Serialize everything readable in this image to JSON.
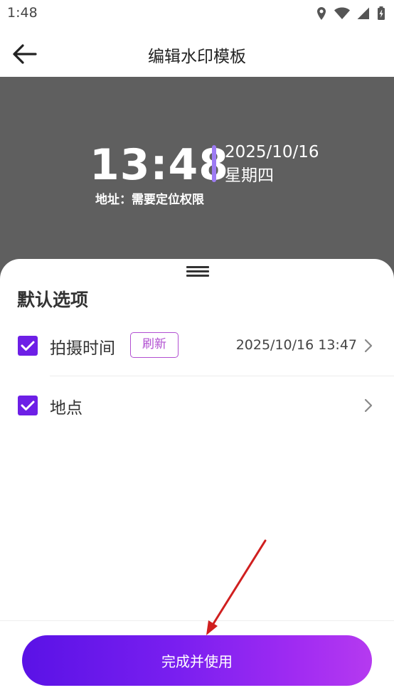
{
  "status_bar": {
    "time": "1:48",
    "icons": [
      "location-icon",
      "wifi-icon",
      "signal-icon",
      "battery-charging-icon"
    ]
  },
  "app_bar": {
    "title": "编辑水印模板",
    "back_icon": "arrow-left-icon"
  },
  "watermark_preview": {
    "time": "13:48",
    "date": "2025/10/16",
    "weekday": "星期四",
    "address": "地址：需要定位权限",
    "accent_color": "#9d7bf3",
    "background_color": "#5f5f5f"
  },
  "sheet": {
    "title": "默认选项",
    "items": [
      {
        "label": "拍摄时间",
        "checked": true,
        "action_label": "刷新",
        "value": "2025/10/16  13:47"
      },
      {
        "label": "地点",
        "checked": true,
        "value": ""
      }
    ]
  },
  "footer": {
    "primary_button_label": "完成并使用"
  },
  "colors": {
    "accent": "#6d1fe6",
    "refresh_border": "#b14fd1",
    "annotation_arrow": "#d01f1f"
  }
}
